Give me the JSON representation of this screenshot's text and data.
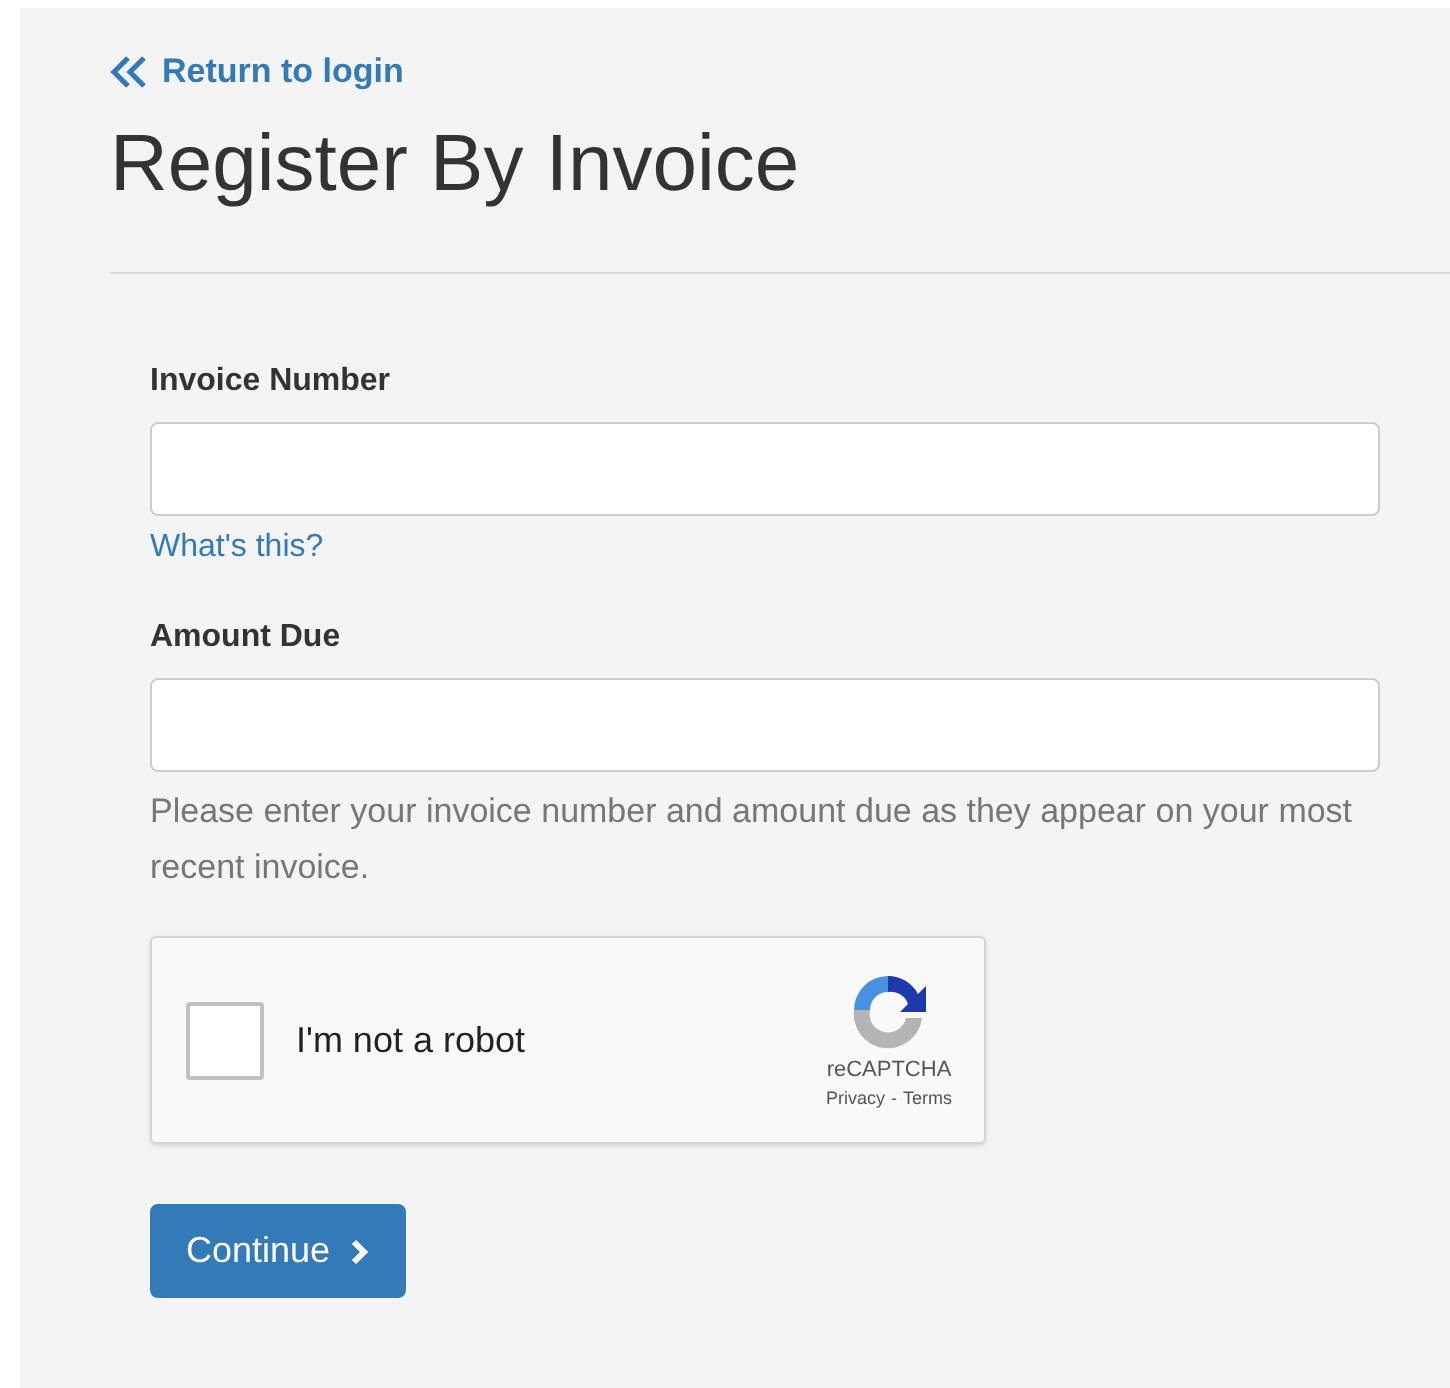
{
  "back_link": {
    "label": "Return to login"
  },
  "title": "Register By Invoice",
  "fields": [
    {
      "label": "Invoice Number",
      "help_link": "What's this?"
    },
    {
      "label": "Amount Due"
    }
  ],
  "hint": "Please enter your invoice number and amount due as they appear on your most recent invoice.",
  "captcha": {
    "label": "I'm not a robot",
    "checked": false,
    "brand": "reCAPTCHA",
    "privacy": "Privacy",
    "separator": "-",
    "terms": "Terms"
  },
  "submit": {
    "label": "Continue"
  }
}
